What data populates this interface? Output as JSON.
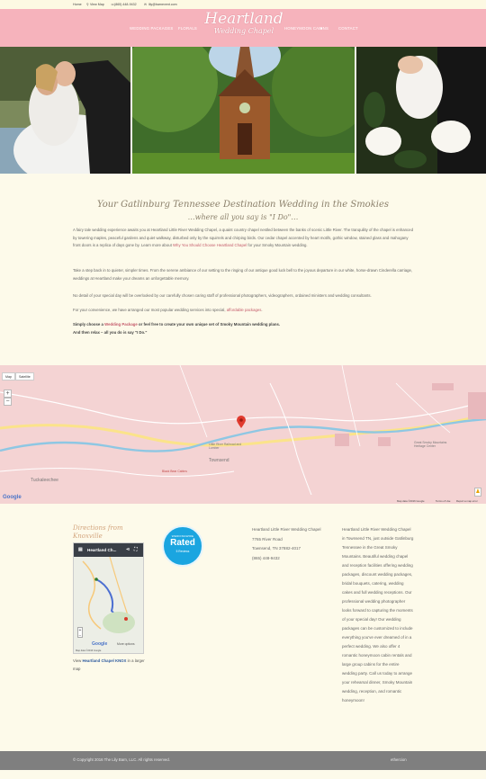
{
  "topbar": {
    "home": "Home",
    "view_map": "View Map",
    "phone": "(865) 448-9432",
    "email": "lily@barnevent.com"
  },
  "nav": {
    "item1": "WEDDING PACKAGES",
    "item2": "FLORALS",
    "item3": "HONEYMOON CABINS",
    "item4": "CONTACT"
  },
  "logo": {
    "line1": "Heartland",
    "line2": "Wedding Chapel"
  },
  "intro": {
    "title": "Your Gatlinburg Tennessee Destination Wedding in the Smokies",
    "subtitle": "…where all you say is \"I Do\"…",
    "p1a": "A fairy tale wedding experience awaits you at Heartland Little River Wedding Chapel, a quaint country chapel nestled between the banks of scenic Little River. The tranquility of the chapel is enhanced by towering maples, peaceful gardens and quiet walkway, disturbed only by the squirrels and chirping birds. Our cedar chapel accented by heart motifs, gothic window, stained glass and mahogany front doors is a replica of days gone by. Learn more about ",
    "p1_link": "Why You Should Choose Heartland Chapel",
    "p1b": " for your Smoky Mountain wedding.",
    "p2": "Take a step back in to quieter, simpler times. From the serene ambiance of our setting to the ringing of our antique good luck bell to the joyous departure in our white, horse-drawn Cinderella carriage, weddings at Heartland make your dreams an unforgettable memory.",
    "p3": "No detail of your special day will be overlooked by our carefully chosen caring staff of professional photographers, videographers, ordained ministers and wedding consultants.",
    "p4a": "For your convenience, we have arranged our most popular wedding services into special, ",
    "p4_link": "affordable packages",
    "p4b": ".",
    "p5a": "Simply choose a ",
    "p5_link": "Wedding Package",
    "p5b": " or feel free to create your own unique set of Smoky Mountain wedding plans.",
    "p6": "And then relax – all you do is say \"I Do.\""
  },
  "map": {
    "tab_map": "Map",
    "tab_satellite": "Satellite",
    "zoom_in": "+",
    "zoom_out": "−",
    "google": "Google",
    "attribution": "Map data ©2016 Google",
    "terms": "Terms of Use",
    "report": "Report a map error",
    "label_tuckaleechee": "Tuckaleechee",
    "label_townsend": "Townsend",
    "label_chapel": "Little River Railroad and Lumber",
    "label_heritage": "Great Smoky Mountains Heritage Center",
    "label_black_bear": "Black Bear Cabins"
  },
  "footer": {
    "directions_title_1": "Directions from",
    "directions_title_2": "Knoxville",
    "minimap_title": "Heartland Ch...",
    "minimap_more": "More options",
    "minimap_attribution": "Map data ©2016 Google",
    "view_prefix": "View ",
    "view_link": "Heartland Chapel KNOX",
    "view_suffix": " in a larger map",
    "badge_top": "WEDDINGWIRE",
    "badge_main": "Rated",
    "badge_reviews": "5 Reviews",
    "address_1": "Heartland Little River Wedding Chapel",
    "address_2": "7765 River Road",
    "address_3": "Townsend, TN 37882-4017",
    "address_4": "(865) 448-9432",
    "about": "Heartland Little River Wedding Chapel in Townsend TN, just outside Gatlinburg Tennessee in the Great Smoky Mountains. Beautiful wedding chapel and reception facilities offering wedding packages, discount wedding packages, bridal bouquets, catering, wedding cakes and full wedding receptions. Our professional wedding photographer looks forward to capturing the moments of your special day! Our wedding packages can be customized to include everything you've ever dreamed of in a perfect wedding. We also offer 4 romantic honeymoon cabin rentals and large group cabins for the entire wedding party. Call us today to arrange your rehearsal dinner, Smoky Mountain wedding, reception, and romantic honeymoon!"
  },
  "bottom": {
    "copyright": "© Copyright 2016 The Lily Barn, LLC. All rights reserved.",
    "credit": "ethercion"
  },
  "colors": {
    "header": "#f6b3bc",
    "accent_link": "#c45a6a",
    "background": "#fdfaea",
    "footer_bar": "#7f7f7f",
    "badge": "#1aa5e0"
  }
}
